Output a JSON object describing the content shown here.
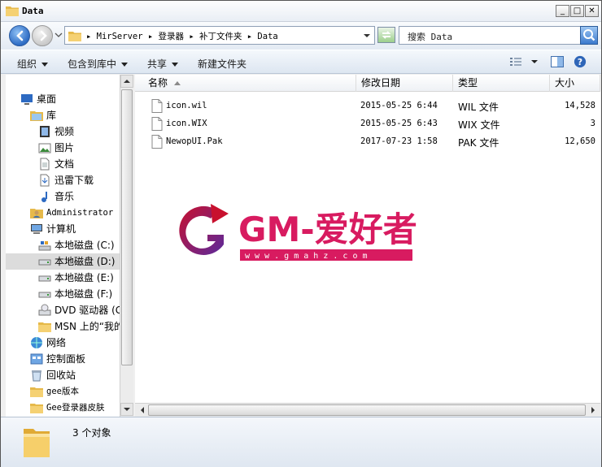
{
  "window": {
    "title": "Data",
    "minimize": "_",
    "maximize": "□",
    "close": "✕"
  },
  "address": {
    "segments": [
      "MirServer",
      "登录器",
      "补丁文件夹",
      "Data"
    ],
    "path_text": "▸ MirServer ▸ 登录器 ▸ 补丁文件夹 ▸ Data"
  },
  "search": {
    "placeholder": "搜索 Data"
  },
  "toolbar": {
    "organize": "组织",
    "include_library": "包含到库中",
    "share": "共享",
    "new_folder": "新建文件夹"
  },
  "nav_tree": [
    {
      "label": "桌面",
      "icon": "desktop-icon"
    },
    {
      "label": "库",
      "icon": "library-icon"
    },
    {
      "label": "视频",
      "icon": "video-icon"
    },
    {
      "label": "图片",
      "icon": "picture-icon"
    },
    {
      "label": "文档",
      "icon": "document-icon"
    },
    {
      "label": "迅雷下载",
      "icon": "download-icon"
    },
    {
      "label": "音乐",
      "icon": "music-icon"
    },
    {
      "label": "Administrator",
      "icon": "user-folder-icon"
    },
    {
      "label": "计算机",
      "icon": "computer-icon"
    },
    {
      "label": "本地磁盘 (C:)",
      "icon": "system-drive-icon"
    },
    {
      "label": "本地磁盘 (D:)",
      "icon": "drive-icon"
    },
    {
      "label": "本地磁盘 (E:)",
      "icon": "drive-icon"
    },
    {
      "label": "本地磁盘 (F:)",
      "icon": "drive-icon"
    },
    {
      "label": "DVD 驱动器 (G",
      "icon": "dvd-drive-icon"
    },
    {
      "label": "MSN 上的“我的",
      "icon": "folder-icon"
    },
    {
      "label": "网络",
      "icon": "network-icon"
    },
    {
      "label": "控制面板",
      "icon": "control-panel-icon"
    },
    {
      "label": "回收站",
      "icon": "recycle-bin-icon"
    },
    {
      "label": "gee版本",
      "icon": "folder-icon"
    },
    {
      "label": "Gee登录器皮肤",
      "icon": "folder-icon"
    }
  ],
  "columns": {
    "name": "名称",
    "modified": "修改日期",
    "type": "类型",
    "size": "大小"
  },
  "files": [
    {
      "name": "icon.wil",
      "modified": "2015-05-25 6:44",
      "type": "WIL 文件",
      "size": "14,528"
    },
    {
      "name": "icon.WIX",
      "modified": "2015-05-25 6:43",
      "type": "WIX 文件",
      "size": "3"
    },
    {
      "name": "NewopUI.Pak",
      "modified": "2017-07-23 1:58",
      "type": "PAK 文件",
      "size": "12,650"
    }
  ],
  "details": {
    "count_text": "3 个对象"
  },
  "watermark": {
    "logo_text": "GM-爱好者",
    "url_text": "w w w . g m a h z . c o m",
    "colors": {
      "gradient_start": "#c8102e",
      "gradient_end": "#5b2a9c",
      "text": "#d81b60"
    }
  },
  "colors": {
    "accent_blue": "#3b79cd",
    "selection_gray": "#dcdcdc",
    "toolbar_bg": "#dde6f1"
  }
}
